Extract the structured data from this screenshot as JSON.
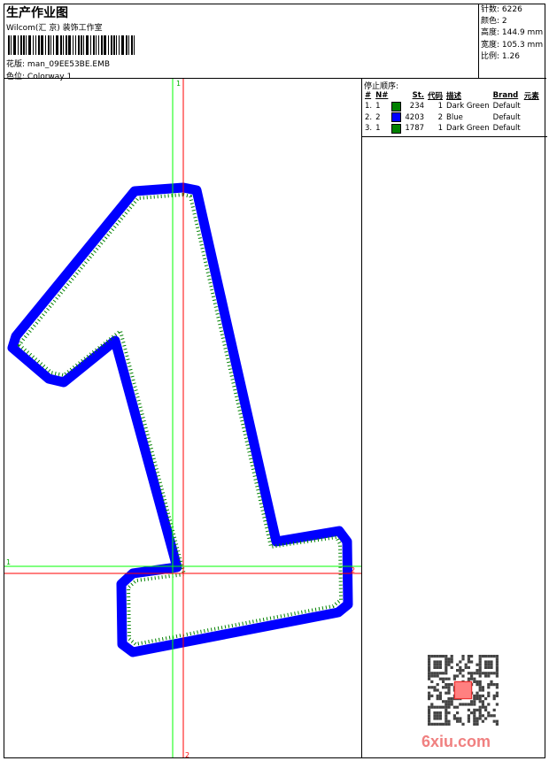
{
  "header": {
    "title": "生产作业图",
    "company": "Wilcom(汇 京) 装饰工作室",
    "design_label": "花版:",
    "design_value": "man_09EE53BE.EMB",
    "colorway_label": "色位:",
    "colorway_value": "Colorway 1"
  },
  "info": [
    {
      "label": "针数:",
      "value": "6226"
    },
    {
      "label": "颜色:",
      "value": "2"
    },
    {
      "label": "高度:",
      "value": "144.9 mm"
    },
    {
      "label": "宽度:",
      "value": "105.3 mm"
    },
    {
      "label": "比例:",
      "value": "1.26"
    }
  ],
  "stop_sequence": {
    "title": "停止顺序:",
    "columns": [
      "#",
      "N#",
      "St.",
      "代码",
      "描述",
      "Brand",
      "元素"
    ],
    "rows": [
      {
        "idx": "1.",
        "n": "1",
        "color": "#008000",
        "st": "234",
        "code": "1",
        "desc": "Dark Green",
        "brand": "Default"
      },
      {
        "idx": "2.",
        "n": "2",
        "color": "#0000ff",
        "st": "4203",
        "code": "2",
        "desc": "Blue",
        "brand": "Default"
      },
      {
        "idx": "3.",
        "n": "1",
        "color": "#008000",
        "st": "1787",
        "code": "1",
        "desc": "Dark Green",
        "brand": "Default"
      }
    ]
  },
  "markers": {
    "top": "1",
    "bottom": "2",
    "left": "1",
    "right": "2"
  },
  "colors": {
    "blue": "#0000ff",
    "green": "#008000",
    "guide_green": "#00ff00",
    "guide_red": "#ff0000"
  },
  "watermark": "6xiu.com"
}
